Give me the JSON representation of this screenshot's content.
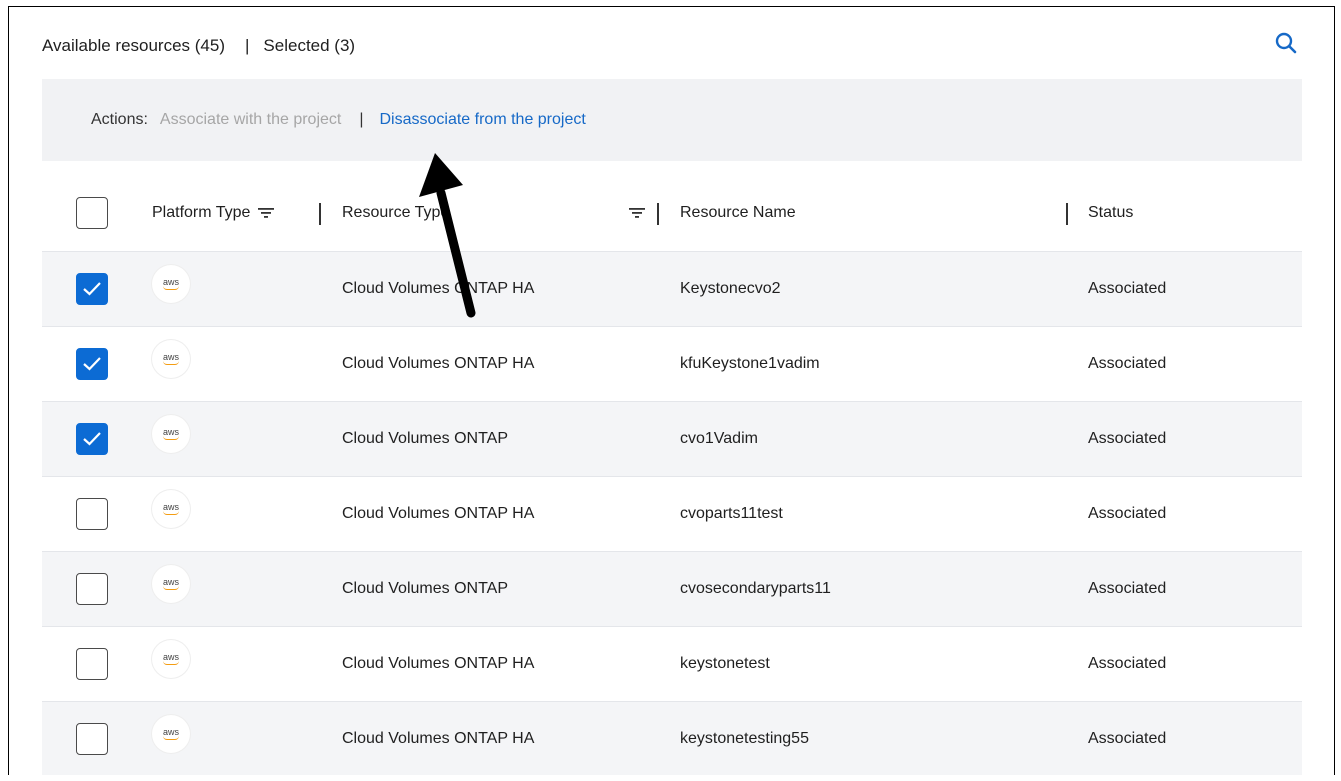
{
  "header": {
    "available_label": "Available resources (45)",
    "separator": "|",
    "selected_label": "Selected (3)"
  },
  "actions": {
    "label": "Actions:",
    "associate": "Associate with the project",
    "separator": "|",
    "disassociate": "Disassociate from the project"
  },
  "columns": {
    "platform": "Platform Type",
    "resource_type": "Resource Type",
    "resource_name": "Resource Name",
    "status": "Status"
  },
  "rows": [
    {
      "checked": true,
      "platform_icon": "aws",
      "type": "Cloud Volumes ONTAP HA",
      "name": "Keystonecvo2",
      "status": "Associated"
    },
    {
      "checked": true,
      "platform_icon": "aws",
      "type": "Cloud Volumes ONTAP HA",
      "name": "kfuKeystone1vadim",
      "status": "Associated"
    },
    {
      "checked": true,
      "platform_icon": "aws",
      "type": "Cloud Volumes ONTAP",
      "name": "cvo1Vadim",
      "status": "Associated"
    },
    {
      "checked": false,
      "platform_icon": "aws",
      "type": "Cloud Volumes ONTAP HA",
      "name": "cvoparts11test",
      "status": "Associated"
    },
    {
      "checked": false,
      "platform_icon": "aws",
      "type": "Cloud Volumes ONTAP",
      "name": "cvosecondaryparts11",
      "status": "Associated"
    },
    {
      "checked": false,
      "platform_icon": "aws",
      "type": "Cloud Volumes ONTAP HA",
      "name": "keystonetest",
      "status": "Associated"
    },
    {
      "checked": false,
      "platform_icon": "aws",
      "type": "Cloud Volumes ONTAP HA",
      "name": "keystonetesting55",
      "status": "Associated"
    }
  ],
  "aws_text": "aws",
  "colors": {
    "accent": "#0c6bd4",
    "link": "#1669c7",
    "disabled": "#a6a6a6",
    "toolbar_bg": "#f1f2f4",
    "row_alt_bg": "#f4f5f7"
  }
}
